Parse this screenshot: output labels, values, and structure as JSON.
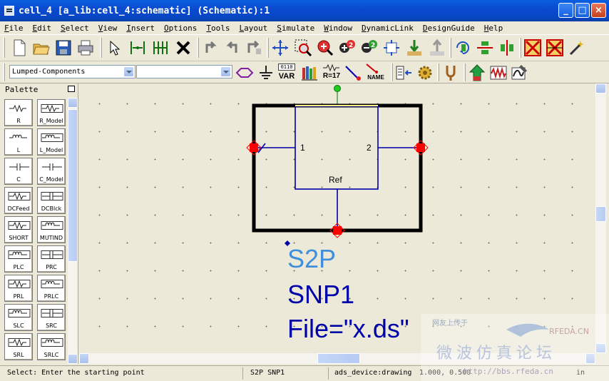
{
  "window": {
    "title": "cell_4 [a_lib:cell_4:schematic] (Schematic):1",
    "buttons": [
      "_",
      "□",
      "×"
    ]
  },
  "menu": [
    "File",
    "Edit",
    "Select",
    "View",
    "Insert",
    "Options",
    "Tools",
    "Layout",
    "Simulate",
    "Window",
    "DynamicLink",
    "DesignGuide",
    "Help"
  ],
  "toolbar2": {
    "library_select": "Lumped-Components",
    "component_select": "",
    "var_label": "VAR",
    "var_bits": "0110",
    "ref_label": "R=17",
    "name_label": "NAME"
  },
  "palette": {
    "title": "Palette",
    "items": [
      {
        "label": "R",
        "icon": "resistor-icon"
      },
      {
        "label": "R_Model",
        "icon": "resistor-model-icon"
      },
      {
        "label": "L",
        "icon": "inductor-icon"
      },
      {
        "label": "L_Model",
        "icon": "inductor-model-icon"
      },
      {
        "label": "C",
        "icon": "capacitor-icon"
      },
      {
        "label": "C_Model",
        "icon": "capacitor-model-icon"
      },
      {
        "label": "DCFeed",
        "icon": "dcfeed-icon"
      },
      {
        "label": "DCBlck",
        "icon": "dcblock-icon"
      },
      {
        "label": "SHORT",
        "icon": "short-icon"
      },
      {
        "label": "MUTIND",
        "icon": "mutual-inductor-icon"
      },
      {
        "label": "PLC",
        "icon": "plc-icon"
      },
      {
        "label": "PRC",
        "icon": "prc-icon"
      },
      {
        "label": "PRL",
        "icon": "prl-icon"
      },
      {
        "label": "PRLC",
        "icon": "prlc-icon"
      },
      {
        "label": "SLC",
        "icon": "slc-icon"
      },
      {
        "label": "SRC",
        "icon": "src-icon"
      },
      {
        "label": "SRL",
        "icon": "srl-icon"
      },
      {
        "label": "SRLC",
        "icon": "srlc-icon"
      }
    ]
  },
  "schematic": {
    "port1_label": "1",
    "port2_label": "2",
    "ref_label": "Ref",
    "component_type": "S2P",
    "instance_name": "SNP1",
    "file_param": "File=\"x.ds\"",
    "colors": {
      "type": "#3f8fdc",
      "params": "#0000a8",
      "wire": "#0000a8",
      "pin": "#ff0000"
    }
  },
  "status": {
    "prompt": "Select: Enter the starting point",
    "selection": "S2P SNP1",
    "layer": "ads_device:drawing",
    "coords": "1.000, 0.500",
    "units": "in"
  },
  "watermark": {
    "top_text": "网友上传于",
    "brand": "RFEDA.CN",
    "cn_text": "微波仿真论坛",
    "url": "http://bbs.rfeda.cn"
  }
}
